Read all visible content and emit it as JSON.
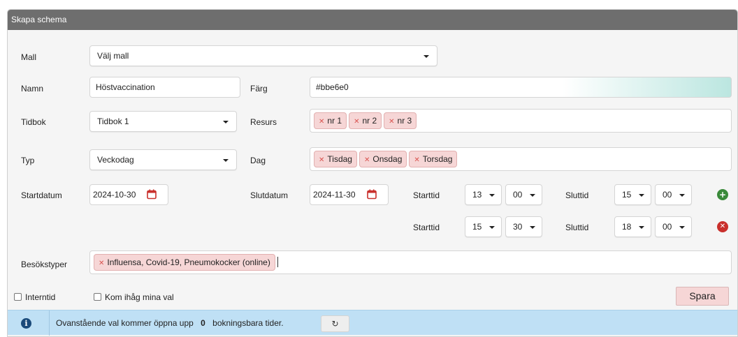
{
  "panel": {
    "title": "Skapa schema"
  },
  "form": {
    "mall": {
      "label": "Mall",
      "value": "Välj mall"
    },
    "namn": {
      "label": "Namn",
      "value": "Höstvaccination"
    },
    "farg": {
      "label": "Färg",
      "value": "#bbe6e0",
      "swatch": "#bbe6e0"
    },
    "tidbok": {
      "label": "Tidbok",
      "value": "Tidbok 1"
    },
    "resurs": {
      "label": "Resurs",
      "tags": [
        "nr 1",
        "nr 2",
        "nr 3"
      ]
    },
    "typ": {
      "label": "Typ",
      "value": "Veckodag"
    },
    "dag": {
      "label": "Dag",
      "tags": [
        "Tisdag",
        "Onsdag",
        "Torsdag"
      ]
    },
    "startdatum": {
      "label": "Startdatum",
      "value": "2024-10-30"
    },
    "slutdatum": {
      "label": "Slutdatum",
      "value": "2024-11-30"
    },
    "time_rows": [
      {
        "start_label": "Starttid",
        "start_hour": "13",
        "start_min": "00",
        "end_label": "Sluttid",
        "end_hour": "15",
        "end_min": "00",
        "action_icon": "add-circle-icon"
      },
      {
        "start_label": "Starttid",
        "start_hour": "15",
        "start_min": "30",
        "end_label": "Sluttid",
        "end_hour": "18",
        "end_min": "00",
        "action_icon": "remove-circle-icon"
      }
    ],
    "besokstyper": {
      "label": "Besökstyper",
      "tags": [
        "Influensa, Covid-19, Pneumokocker (online)"
      ]
    },
    "internid": {
      "label": "Interntid",
      "checked": false
    },
    "kom_ihag": {
      "label": "Kom ihåg mina val",
      "checked": false
    },
    "save_label": "Spara"
  },
  "info": {
    "text_before": "Ovanstående val kommer öppna upp",
    "count": "0",
    "text_after": "bokningsbara tider.",
    "icon": "info-icon",
    "refresh_icon": "refresh-icon"
  },
  "colors": {
    "header_bg": "#6e6e6e",
    "panel_bg": "#f5f5f5",
    "tag_bg": "#f6d6d6",
    "tag_x": "#d9534f",
    "add_icon": "#3a8a3a",
    "remove_icon": "#c9302c",
    "calendar_icon": "#c9302c",
    "info_bar_bg": "#bfe0f5",
    "info_icon": "#1a4a7a"
  }
}
